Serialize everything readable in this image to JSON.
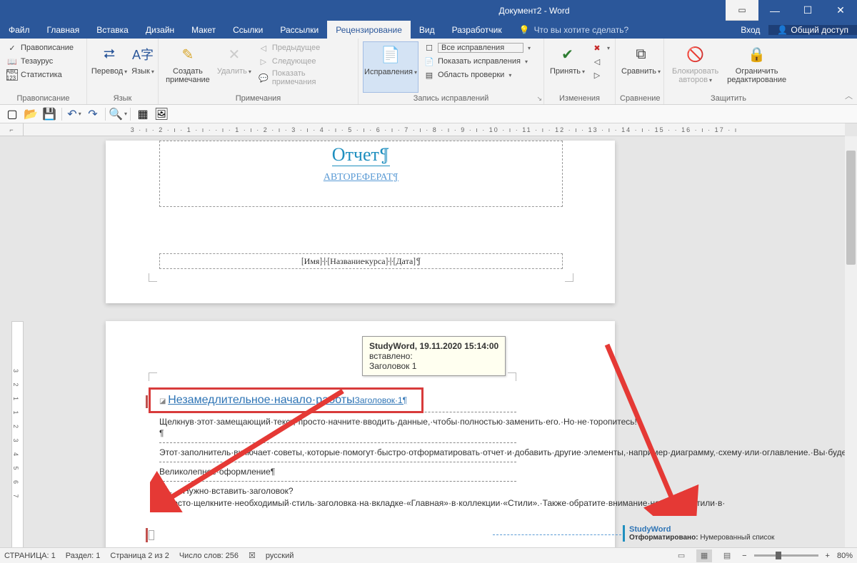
{
  "app": {
    "title": "Документ2 - Word"
  },
  "menu": {
    "file": "Файл",
    "home": "Главная",
    "insert": "Вставка",
    "design": "Дизайн",
    "layout": "Макет",
    "references": "Ссылки",
    "mailings": "Рассылки",
    "review": "Рецензирование",
    "view": "Вид",
    "developer": "Разработчик",
    "tellme": "Что вы хотите сделать?",
    "login": "Вход",
    "share": "Общий доступ"
  },
  "ribbon": {
    "proofing": {
      "label": "Правописание",
      "spelling": "Правописание",
      "thesaurus": "Тезаурус",
      "stats": "Статистика"
    },
    "language": {
      "label": "Язык",
      "translate": "Перевод",
      "language": "Язык"
    },
    "comments": {
      "label": "Примечания",
      "new": "Создать примечание",
      "delete": "Удалить",
      "prev": "Предыдущее",
      "next": "Следующее",
      "show": "Показать примечания"
    },
    "tracking": {
      "label": "Запись исправлений",
      "track": "Исправления",
      "display": "Все исправления",
      "showmarkup": "Показать исправления",
      "pane": "Область проверки"
    },
    "changes": {
      "label": "Изменения",
      "accept": "Принять"
    },
    "compare": {
      "label": "Сравнение",
      "compare": "Сравнить"
    },
    "protect": {
      "label": "Защитить",
      "block": "Блокировать авторов",
      "restrict": "Ограничить редактирование"
    }
  },
  "ruler_text": "3 · ı · 2 · ı · 1 · ı ·    · ı · 1 · ı · 2 · ı · 3 · ı · 4 · ı · 5 · ı · 6 · ı · 7 · ı · 8 · ı · 9 · ı · 10 · ı · 11 · ı · 12 · ı · 13 · ı · 14 · ı · 15 ·    · 16 · ı · 17 · ı",
  "vruler_text": "3  2  1     1  2  3  4  5  6  7",
  "doc": {
    "title": "Отчет¶",
    "subtitle": "АВТОРЕФЕРАТ¶",
    "meta": "[Имя]·|·[Название·курса]·|·[Дата]¶",
    "heading": "Незамедлительное·начало·работы",
    "heading_ins": "Заголовок·1¶",
    "p1": "Щелкнув·этот·замещающий·текст,·просто·начните·вводить·данные,·чтобы·полностью·заменить·его.·Но·не·торопитесь!¶",
    "p2": "Этот·заполнитель·включает·советы,·которые·помогут·быстро·отформатировать·отчет·и·добавить·другие·элементы,·например·диаграмму,·схему·или·оглавление.·Вы·будете·удивлены,·насколько·это·просто.¶",
    "p3": "Великолепное·оформление¶",
    "p4": "Нужно·вставить·заголовок?·Просто·щелкните·необходимый·стиль·заголовка·на·вкладке·«Главная»·в·коллекции·«Стили».·Также·обратите·внимание·на·другие·стили·в·"
  },
  "tooltip": {
    "line1": "StudyWord, 19.11.2020 15:14:00",
    "line2": "вставлено:",
    "line3": "Заголовок 1"
  },
  "revision": {
    "author": "StudyWord",
    "label": "Отформатировано:",
    "value": "Нумерованный список"
  },
  "status": {
    "page": "СТРАНИЦА: 1",
    "section": "Раздел: 1",
    "pageof": "Страница 2 из 2",
    "words": "Число слов: 256",
    "lang": "русский",
    "zoom": "80%"
  }
}
